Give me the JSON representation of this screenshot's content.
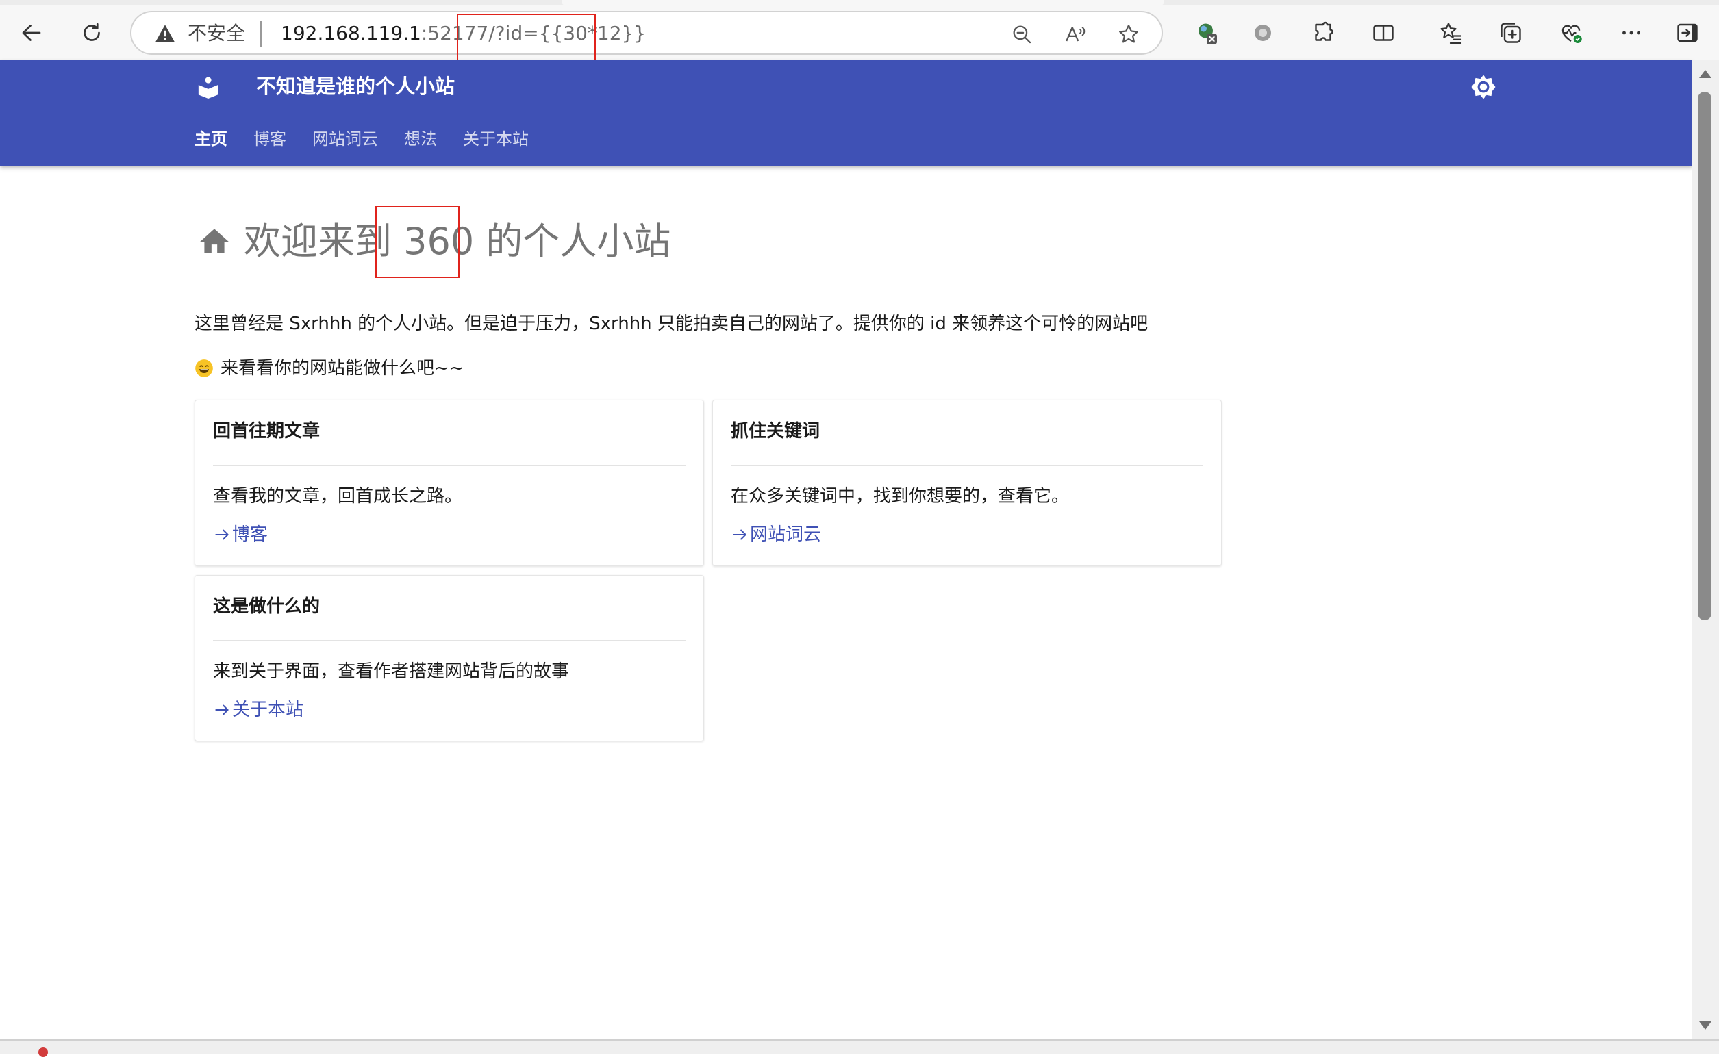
{
  "browser": {
    "security_label": "不安全",
    "url_host": "192.168.119.1",
    "url_rest": ":52177/?id={{30*12}}",
    "buttons": [
      "back",
      "refresh",
      "zoom-out",
      "read-aloud",
      "favorite",
      "extension-x",
      "circle-extension",
      "extensions",
      "split-screen",
      "favorites",
      "collections",
      "browser-essentials",
      "more",
      "sidebar-exit"
    ]
  },
  "site": {
    "title": "不知道是谁的个人小站",
    "nav": [
      {
        "label": "主页",
        "active": true
      },
      {
        "label": "博客",
        "active": false
      },
      {
        "label": "网站词云",
        "active": false
      },
      {
        "label": "想法",
        "active": false
      },
      {
        "label": "关于本站",
        "active": false
      }
    ],
    "header_color": "#3f51b5"
  },
  "main": {
    "heading_prefix": "欢迎来到",
    "heading_number": "360",
    "heading_suffix": "的个人小站",
    "intro": "这里曾经是 Sxrhhh 的个人小站。但是迫于压力，Sxrhhh 只能拍卖自己的网站了。提供你的 id 来领养这个可怜的网站吧",
    "intro2": "来看看你的网站能做什么吧~~",
    "cards": [
      {
        "title": "回首往期文章",
        "text": "查看我的文章，回首成长之路。",
        "link": "博客"
      },
      {
        "title": "抓住关键词",
        "text": "在众多关键词中，找到你想要的，查看它。",
        "link": "网站词云"
      },
      {
        "title": "这是做什么的",
        "text": "来到关于界面，查看作者搭建网站背后的故事",
        "link": "关于本站"
      }
    ]
  },
  "annotation_color": "#e0231c"
}
